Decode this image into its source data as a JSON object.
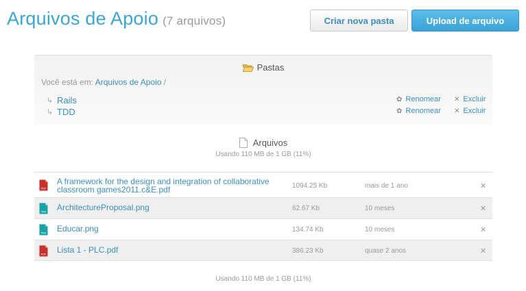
{
  "header": {
    "title": "Arquivos de Apoio",
    "count": "(7 arquivos)",
    "new_folder_button": "Criar nova pasta",
    "upload_button": "Upload de arquivo"
  },
  "folders": {
    "heading": "Pastas",
    "breadcrumb_prefix": "Você está em:",
    "breadcrumb_link": "Arquivos de Apoio",
    "breadcrumb_sep": "/",
    "items": [
      {
        "name": "Rails",
        "rename": "Renomear",
        "delete": "Excluir"
      },
      {
        "name": "TDD",
        "rename": "Renomear",
        "delete": "Excluir"
      }
    ]
  },
  "files": {
    "heading": "Arquivos",
    "usage_top": "Usando 110 MB de 1 GB (11%)",
    "usage_bottom": "Usando 110 MB de 1 GB (11%)",
    "items": [
      {
        "name": "A framework for the design and integration of collaborative classroom games2011.c&E.pdf",
        "size": "1094.25 Kb",
        "date": "mais de 1 ano",
        "icon": "pdf-icon"
      },
      {
        "name": "ArchitectureProposal.png",
        "size": "62.67 Kb",
        "date": "10 meses",
        "icon": "png-icon"
      },
      {
        "name": "Educar.png",
        "size": "134.74 Kb",
        "date": "10 meses",
        "icon": "png-icon"
      },
      {
        "name": "Lista 1 - PLC.pdf",
        "size": "386.23 Kb",
        "date": "quase 2 anos",
        "icon": "pdf-icon"
      }
    ]
  },
  "icons": {
    "pdf_label": "PDF",
    "png_label": "PNG",
    "rename_glyph": "✿",
    "delete_glyph": "✕",
    "folder_arrow": "↳",
    "row_delete": "✕"
  },
  "colors": {
    "accent": "#3aa6d3",
    "link": "#3a8ec0",
    "pdf": "#c9302c",
    "png": "#17a3a3"
  }
}
